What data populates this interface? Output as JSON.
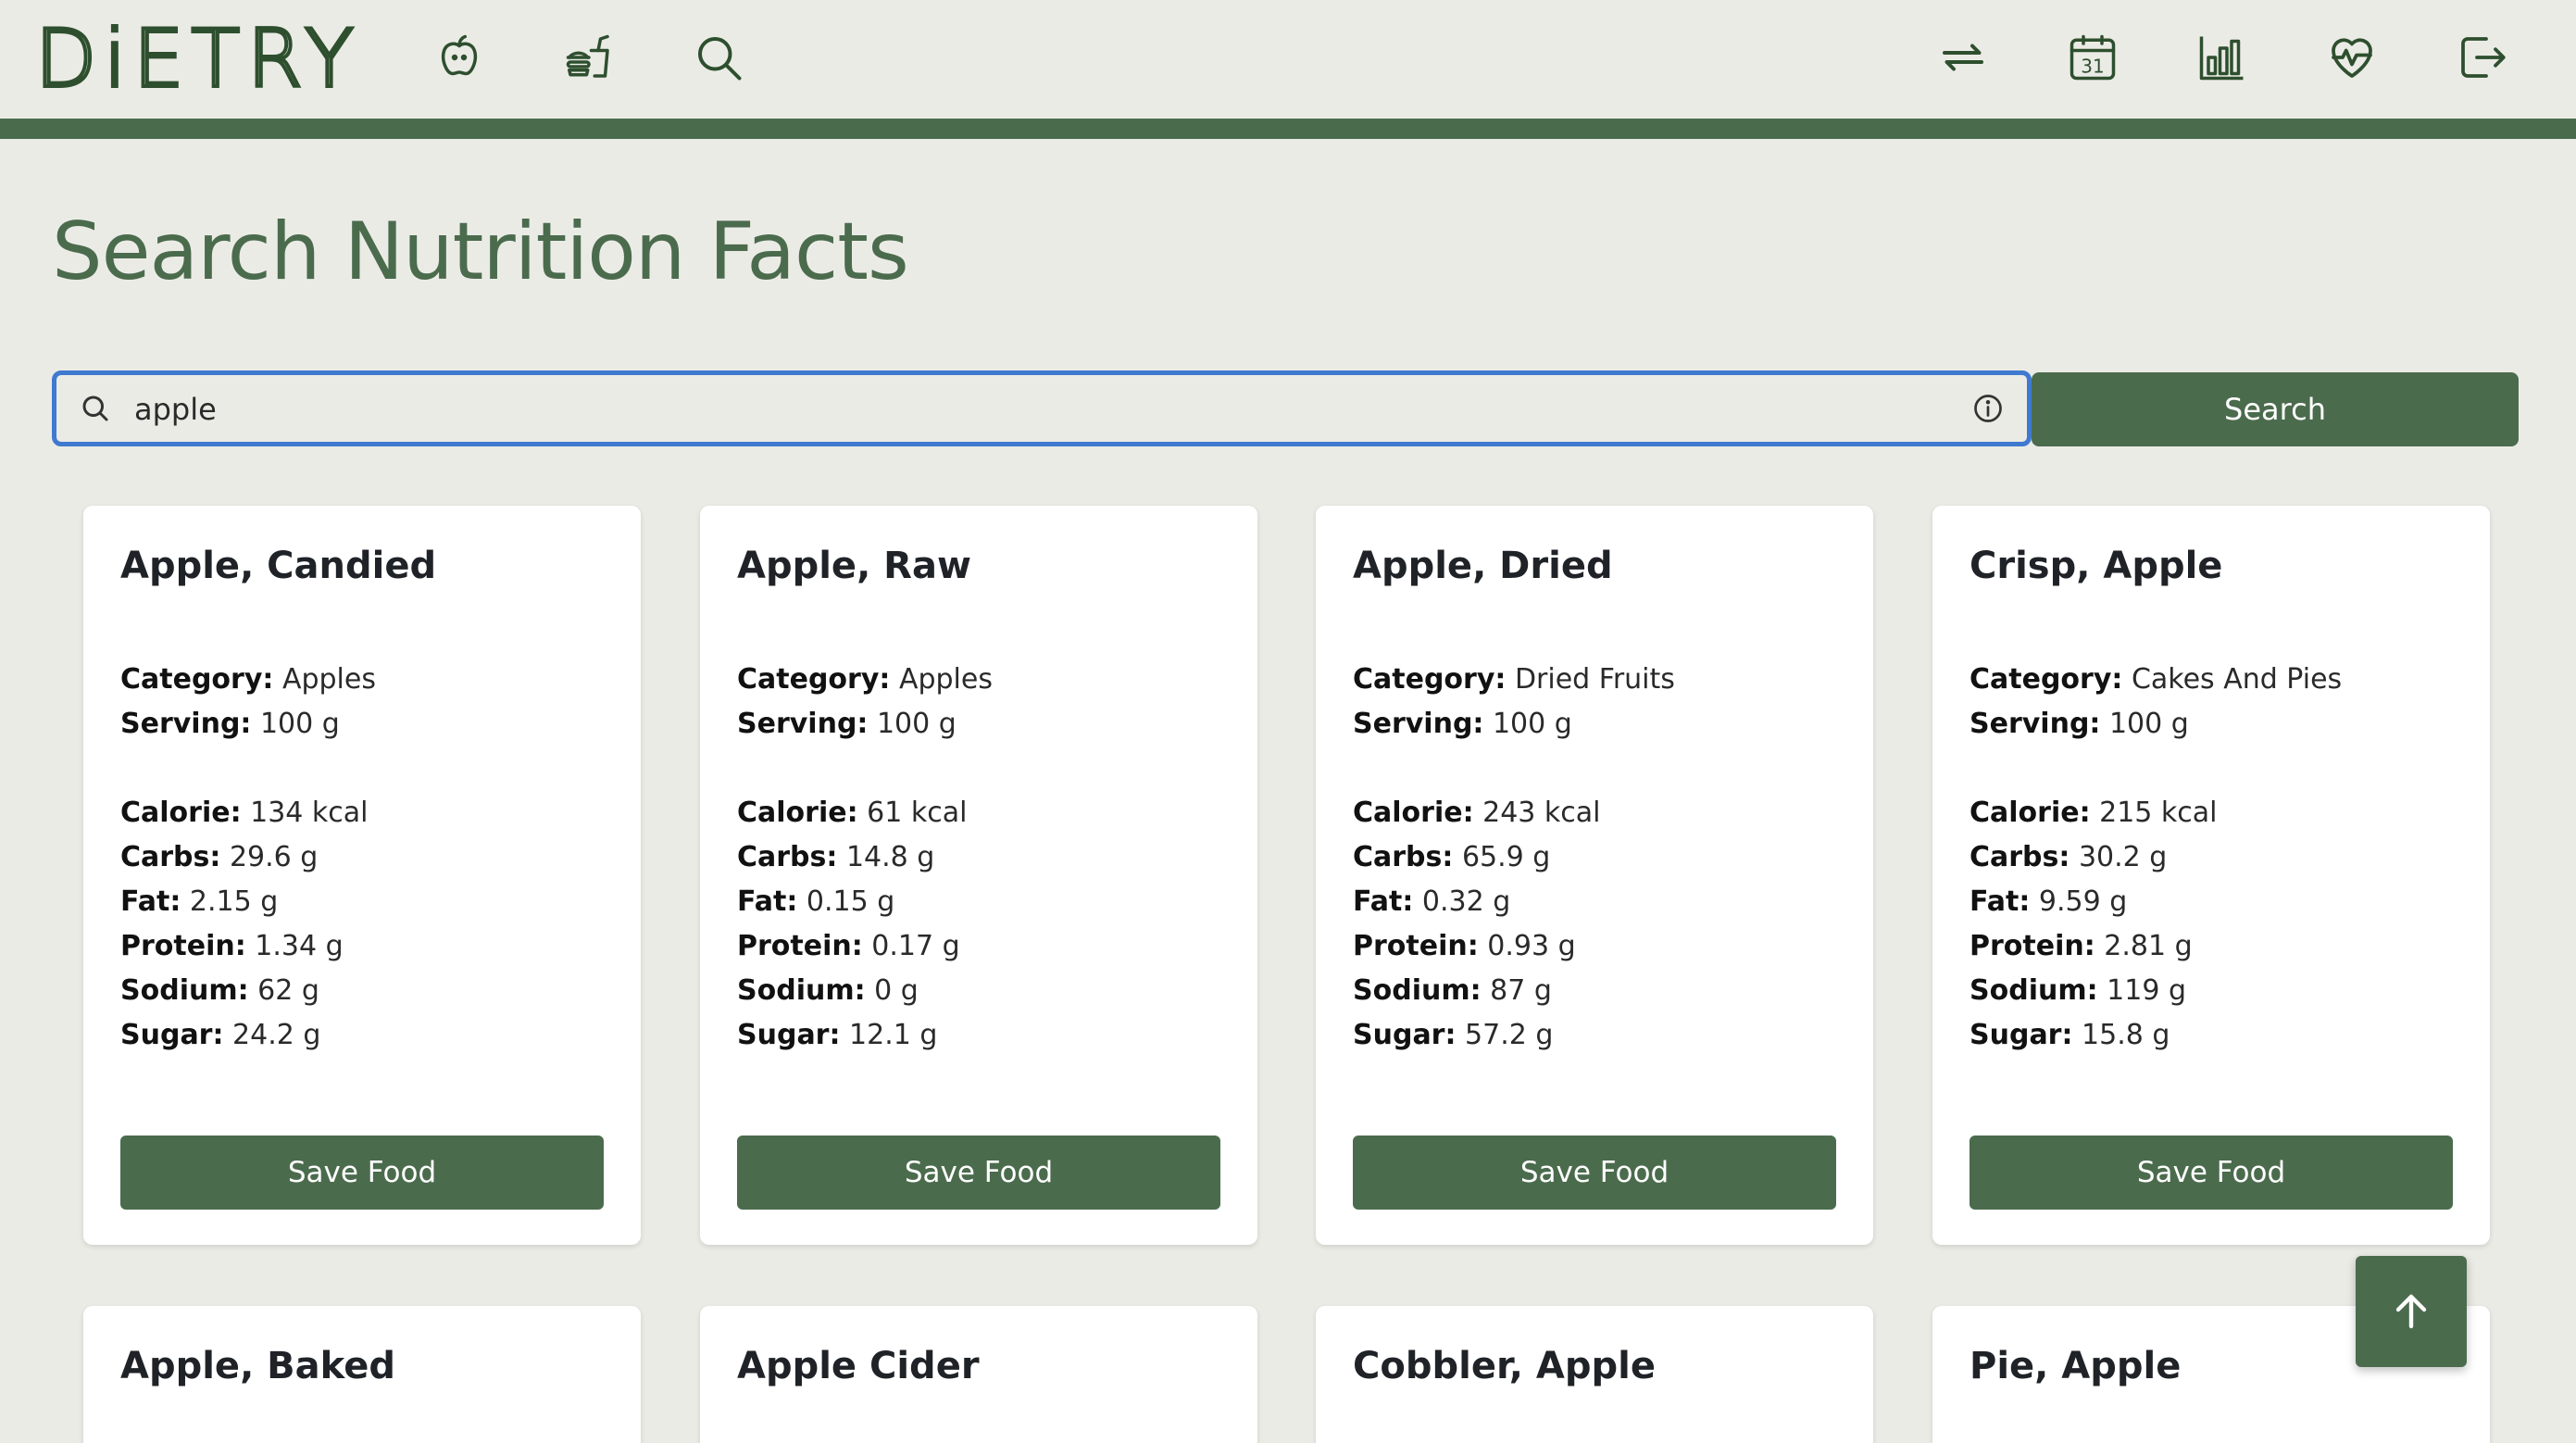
{
  "app": {
    "logo_text": "DiETRY"
  },
  "nav": {
    "left_icons": [
      "apple-icon",
      "fast-food-icon",
      "search-icon"
    ],
    "right_icons": [
      "swap-icon",
      "calendar-icon",
      "bar-chart-icon",
      "heart-pulse-icon",
      "logout-icon"
    ],
    "calendar_day": "31"
  },
  "page": {
    "title": "Search Nutrition Facts"
  },
  "search": {
    "value": "apple",
    "placeholder": "",
    "button_label": "Search"
  },
  "labels": {
    "category": "Category:",
    "serving": "Serving:",
    "calorie": "Calorie:",
    "carbs": "Carbs:",
    "fat": "Fat:",
    "protein": "Protein:",
    "sodium": "Sodium:",
    "sugar": "Sugar:"
  },
  "foods": [
    {
      "name": "Apple, Candied",
      "category": "Apples",
      "serving": "100 g",
      "calorie": "134 kcal",
      "carbs": "29.6 g",
      "fat": "2.15 g",
      "protein": "1.34 g",
      "sodium": "62 g",
      "sugar": "24.2 g",
      "save_label": "Save Food"
    },
    {
      "name": "Apple, Raw",
      "category": "Apples",
      "serving": "100 g",
      "calorie": "61 kcal",
      "carbs": "14.8 g",
      "fat": "0.15 g",
      "protein": "0.17 g",
      "sodium": "0 g",
      "sugar": "12.1 g",
      "save_label": "Save Food"
    },
    {
      "name": "Apple, Dried",
      "category": "Dried Fruits",
      "serving": "100 g",
      "calorie": "243 kcal",
      "carbs": "65.9 g",
      "fat": "0.32 g",
      "protein": "0.93 g",
      "sodium": "87 g",
      "sugar": "57.2 g",
      "save_label": "Save Food"
    },
    {
      "name": "Crisp, Apple",
      "category": "Cakes And Pies",
      "serving": "100 g",
      "calorie": "215 kcal",
      "carbs": "30.2 g",
      "fat": "9.59 g",
      "protein": "2.81 g",
      "sodium": "119 g",
      "sugar": "15.8 g",
      "save_label": "Save Food"
    },
    {
      "name": "Apple, Baked"
    },
    {
      "name": "Apple Cider"
    },
    {
      "name": "Cobbler, Apple"
    },
    {
      "name": "Pie, Apple"
    }
  ],
  "colors": {
    "primary": "#4b6b4d",
    "background": "#ebebe6",
    "focus": "#3f7ad0"
  }
}
